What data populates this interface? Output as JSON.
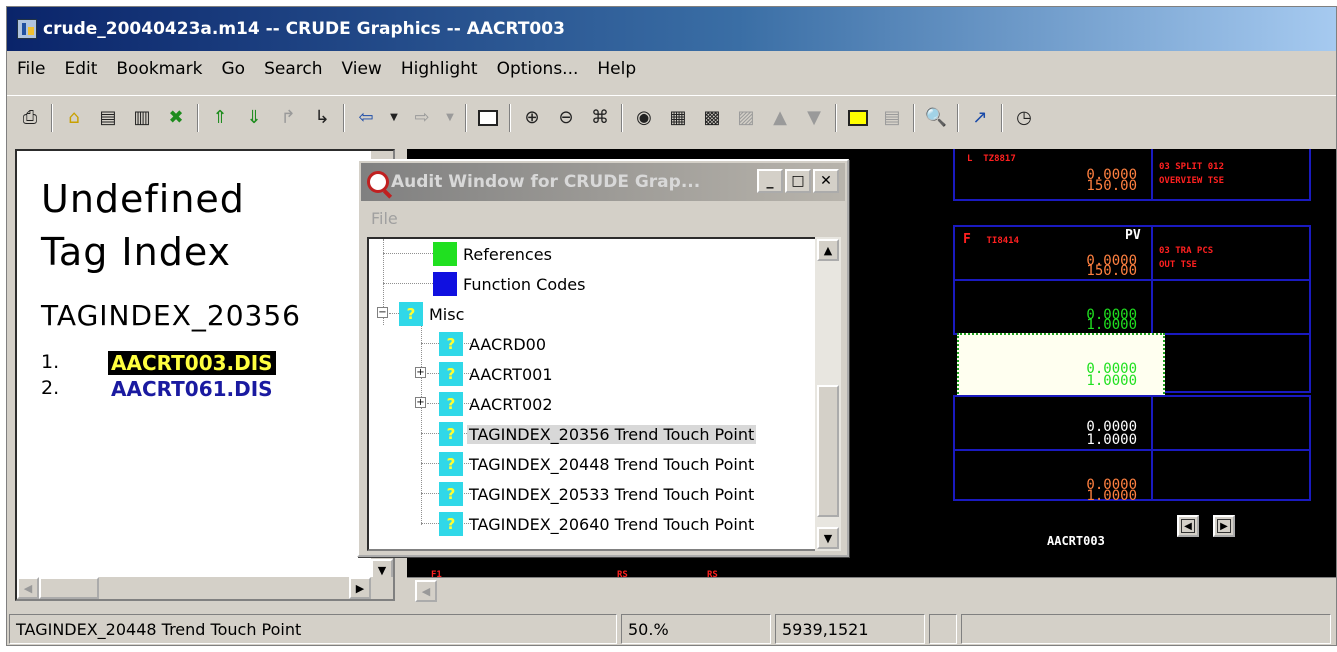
{
  "window": {
    "title": "crude_20040423a.m14 -- CRUDE Graphics -- AACRT003"
  },
  "menu": {
    "items": [
      "File",
      "Edit",
      "Bookmark",
      "Go",
      "Search",
      "View",
      "Highlight",
      "Options...",
      "Help"
    ]
  },
  "left_pane": {
    "heading_line1": "Undefined",
    "heading_line2": "Tag Index",
    "tag_index": "TAGINDEX_20356",
    "references": [
      {
        "num": "1.",
        "name": "AACRT003.DIS"
      },
      {
        "num": "2.",
        "name": "AACRT061.DIS"
      }
    ]
  },
  "audit": {
    "title": "Audit Window for CRUDE Grap...",
    "menu_file": "File",
    "tree": {
      "references": "References",
      "function_codes": "Function Codes",
      "misc": "Misc",
      "misc_children": [
        "AACRD00",
        "AACRT001",
        "AACRT002",
        "TAGINDEX_20356 Trend Touch Point",
        "TAGINDEX_20448 Trend Touch Point",
        "TAGINDEX_20533 Trend Touch Point",
        "TAGINDEX_20640 Trend Touch Point"
      ],
      "icon_glyph": "?"
    }
  },
  "graphics": {
    "pv_label": "PV",
    "values": [
      {
        "top": "0.0000",
        "bottom": "150.00"
      },
      {
        "top": "0.0000",
        "bottom": "150.00"
      },
      {
        "top": "0.0000",
        "bottom": "1.0000"
      },
      {
        "top": "0.0000",
        "bottom": "1.0000"
      },
      {
        "top": "0.0000",
        "bottom": "1.0000"
      },
      {
        "top": "0.0000",
        "bottom": "1.0000"
      }
    ],
    "display_name": "AACRT003"
  },
  "status": {
    "message": "TAGINDEX_20448 Trend Touch Point",
    "zoom": "50.%",
    "coords": "5939,1521"
  },
  "colors": {
    "title_gradient_start": "#0a246a",
    "graphics_bg": "#000000",
    "cell_border": "#1a1ac0",
    "selected_link_bg": "#000000",
    "selected_link_fg": "#ffff40"
  }
}
